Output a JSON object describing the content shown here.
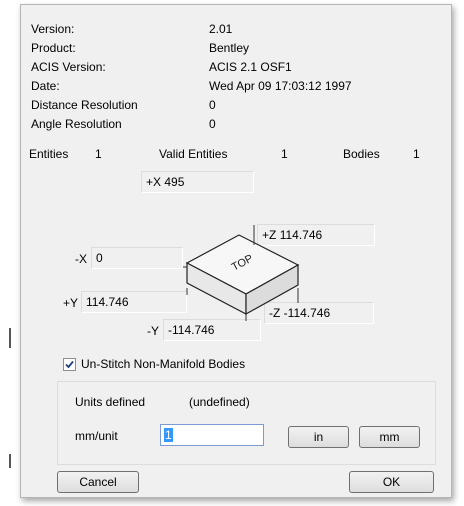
{
  "info": [
    {
      "label": "Version:",
      "value": "2.01"
    },
    {
      "label": "Product:",
      "value": "Bentley"
    },
    {
      "label": "ACIS Version:",
      "value": "ACIS 2.1 OSF1"
    },
    {
      "label": "Date:",
      "value": "Wed Apr 09 17:03:12 1997"
    },
    {
      "label": "Distance Resolution",
      "value": "0"
    },
    {
      "label": "Angle Resolution",
      "value": "0"
    }
  ],
  "counts": {
    "entities_label": "Entities",
    "entities_value": "1",
    "valid_label": "Valid Entities",
    "valid_value": "1",
    "bodies_label": "Bodies",
    "bodies_value": "1"
  },
  "extents": {
    "pos_x_label": "+X",
    "pos_x_value": "495",
    "pos_z_label": "+Z",
    "pos_z_value": "114.746",
    "neg_x_label": "-X",
    "neg_x_value": "0",
    "pos_y_label": "+Y",
    "pos_y_value": "114.746",
    "neg_z_label": "-Z",
    "neg_z_value": "-114.746",
    "neg_y_label": "-Y",
    "neg_y_value": "-114.746",
    "box_top_label": "TOP"
  },
  "unstitch": {
    "label": "Un-Stitch Non-Manifold Bodies",
    "checked": true
  },
  "units": {
    "defined_label": "Units defined",
    "defined_value": "(undefined)",
    "mm_unit_label": "mm/unit",
    "mm_unit_value": "1",
    "in_button": "in",
    "mm_button": "mm"
  },
  "buttons": {
    "cancel": "Cancel",
    "ok": "OK"
  },
  "colors": {
    "selection": "#3399ff",
    "dialog_bg": "#f0f0f0"
  }
}
